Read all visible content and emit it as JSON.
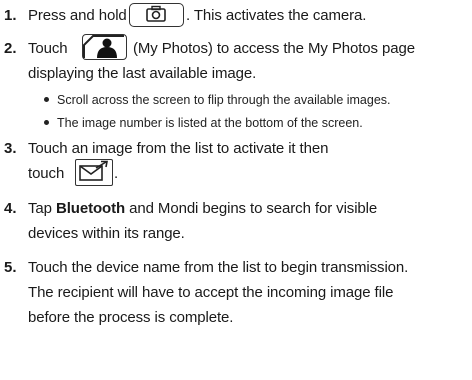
{
  "steps": [
    {
      "number": "1.",
      "pre": "Press and hold",
      "post": ". This activates the camera.",
      "icon": "camera-icon"
    },
    {
      "number": "2.",
      "pre": "Touch",
      "post": "(My Photos) to access the My Photos page",
      "line2": "displaying the last available image.",
      "icon": "my-photos-icon",
      "bullets": [
        "Scroll across the screen to flip through the available images.",
        "The image number is listed at the bottom of the screen."
      ]
    },
    {
      "number": "3.",
      "line1": "Touch an image from the list to activate it then",
      "pre2": "touch",
      "post2": ".",
      "icon": "send-message-icon"
    },
    {
      "number": "4.",
      "pre": "Tap",
      "bold": "Bluetooth",
      "post": "and Mondi begins to search for visible",
      "line2": "devices within its range."
    },
    {
      "number": "5.",
      "line1": "Touch the device name from the list to begin transmission.",
      "line2": "The recipient will have to accept the incoming image file",
      "line3": "before the process is complete."
    }
  ]
}
